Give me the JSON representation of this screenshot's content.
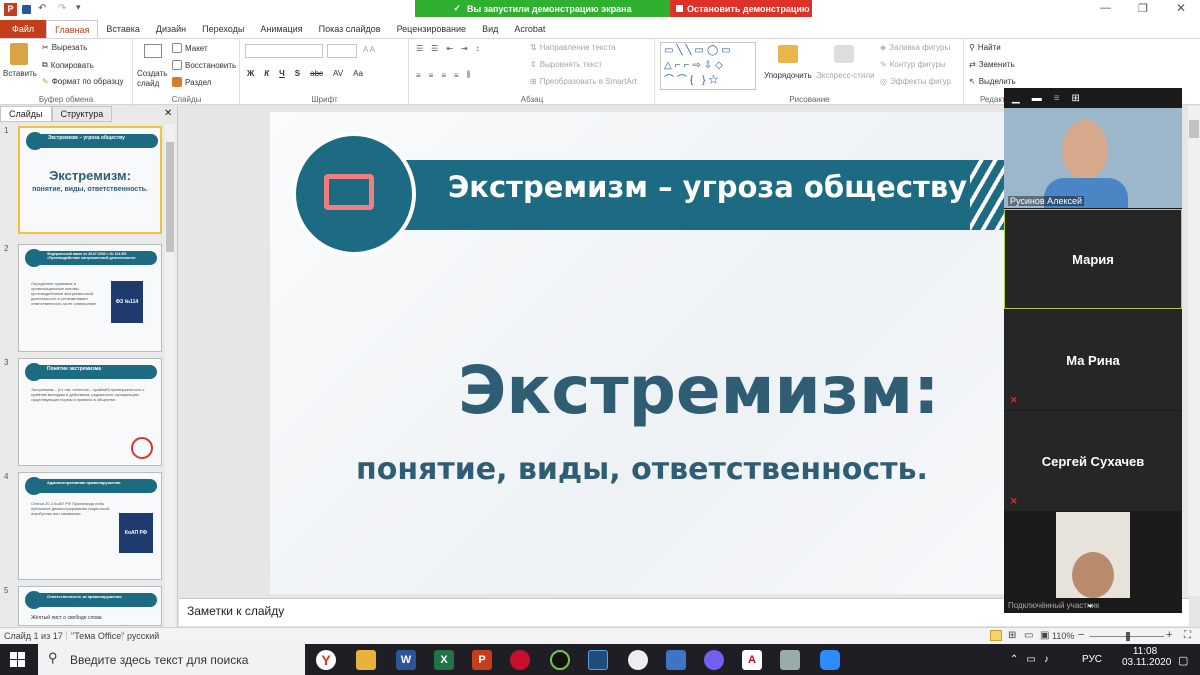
{
  "titlebar": {
    "quick_icons": [
      "save-icon",
      "undo-icon",
      "redo-icon",
      "customize-icon"
    ]
  },
  "zoom_banner": {
    "text": "Вы запустили демонстрацию экрана",
    "stop_label": "Остановить демонстрацию"
  },
  "tabs": [
    "Файл",
    "Главная",
    "Вставка",
    "Дизайн",
    "Переходы",
    "Анимация",
    "Показ слайдов",
    "Рецензирование",
    "Вид",
    "Acrobat"
  ],
  "ribbon": {
    "paste": "Вставить",
    "cut": "Вырезать",
    "copy": "Копировать",
    "format_painter": "Формат по образцу",
    "clipboard": "Буфер обмена",
    "new_slide": "Создать слайд",
    "layout": "Макет",
    "reset": "Восстановить",
    "section": "Раздел",
    "slides": "Слайды",
    "font": "Шрифт",
    "font_btns": [
      "Ж",
      "К",
      "Ч",
      "S",
      "abc",
      "AV",
      "Aa"
    ],
    "text_direction": "Направление текста",
    "align_text": "Выровнять текст",
    "convert_smartart": "Преобразовать в SmartArt",
    "paragraph": "Абзац",
    "arrange": "Упорядочить",
    "quick_styles": "Экспресс-стили",
    "shape_fill": "Заливка фигуры",
    "shape_outline": "Контур фигуры",
    "shape_effects": "Эффекты фигур",
    "drawing": "Рисование",
    "find": "Найти",
    "replace": "Заменить",
    "select": "Выделить",
    "editing": "Редакти"
  },
  "left_panel": {
    "tabs": [
      "Слайды",
      "Структура"
    ],
    "thumbs": [
      {
        "num": "1",
        "title": "Экстремизм – угроза обществу",
        "big": "Экстремизм:",
        "sub": "понятие, виды, ответственность."
      },
      {
        "num": "2",
        "title": "Федеральный закон от 25.07.2002 г. № 114-ФЗ «Противодействие экстремистской деятельности»",
        "body": "Определяет правовые и организационные основы противодействия экстремистской деятельности и устанавливает ответственность за ее совершение",
        "badge": "ФЗ №114"
      },
      {
        "num": "3",
        "title": "Понятие экстремизма",
        "body": "Экстремизм – (от лат. extremus – крайний) приверженность к крайним взглядам и действиям, радикально отрицающим существующие нормы и правила в обществе."
      },
      {
        "num": "4",
        "title": "Административная правонарушения",
        "body": "Статья 20.3 КоАП РФ Пропаганда либо публичное демонстрирование нацистской атрибутики или символики",
        "badge": "КоАП РФ"
      },
      {
        "num": "5",
        "title": "Ответственность за правонарушения",
        "body": "Жёлтый лист о свободе слова"
      }
    ]
  },
  "slide": {
    "banner_title": "Экстремизм – угроза обществу",
    "main_title": "Экстремизм:",
    "subtitle": "понятие, виды, ответственность."
  },
  "notes": {
    "placeholder": "Заметки к слайду"
  },
  "gallery": {
    "participants": [
      "Русинов Алексей",
      "Мария",
      "Ма Рина",
      "Сергей Сухачев",
      "Подключённый участник"
    ]
  },
  "status": {
    "slide_info": "Слайд 1 из 17",
    "theme": "\"Тема Office\"",
    "language": "русский",
    "zoom": "110%"
  },
  "taskbar": {
    "search_placeholder": "Введите здесь текст для поиска",
    "lang": "РУС",
    "time": "11:08",
    "date": "03.11.2020"
  },
  "colors": {
    "accent": "#1d6b82",
    "title_text": "#2f5d74",
    "zoom_green": "#2fb12f",
    "zoom_red": "#e0302a",
    "ppt_orange": "#c43e1c"
  }
}
